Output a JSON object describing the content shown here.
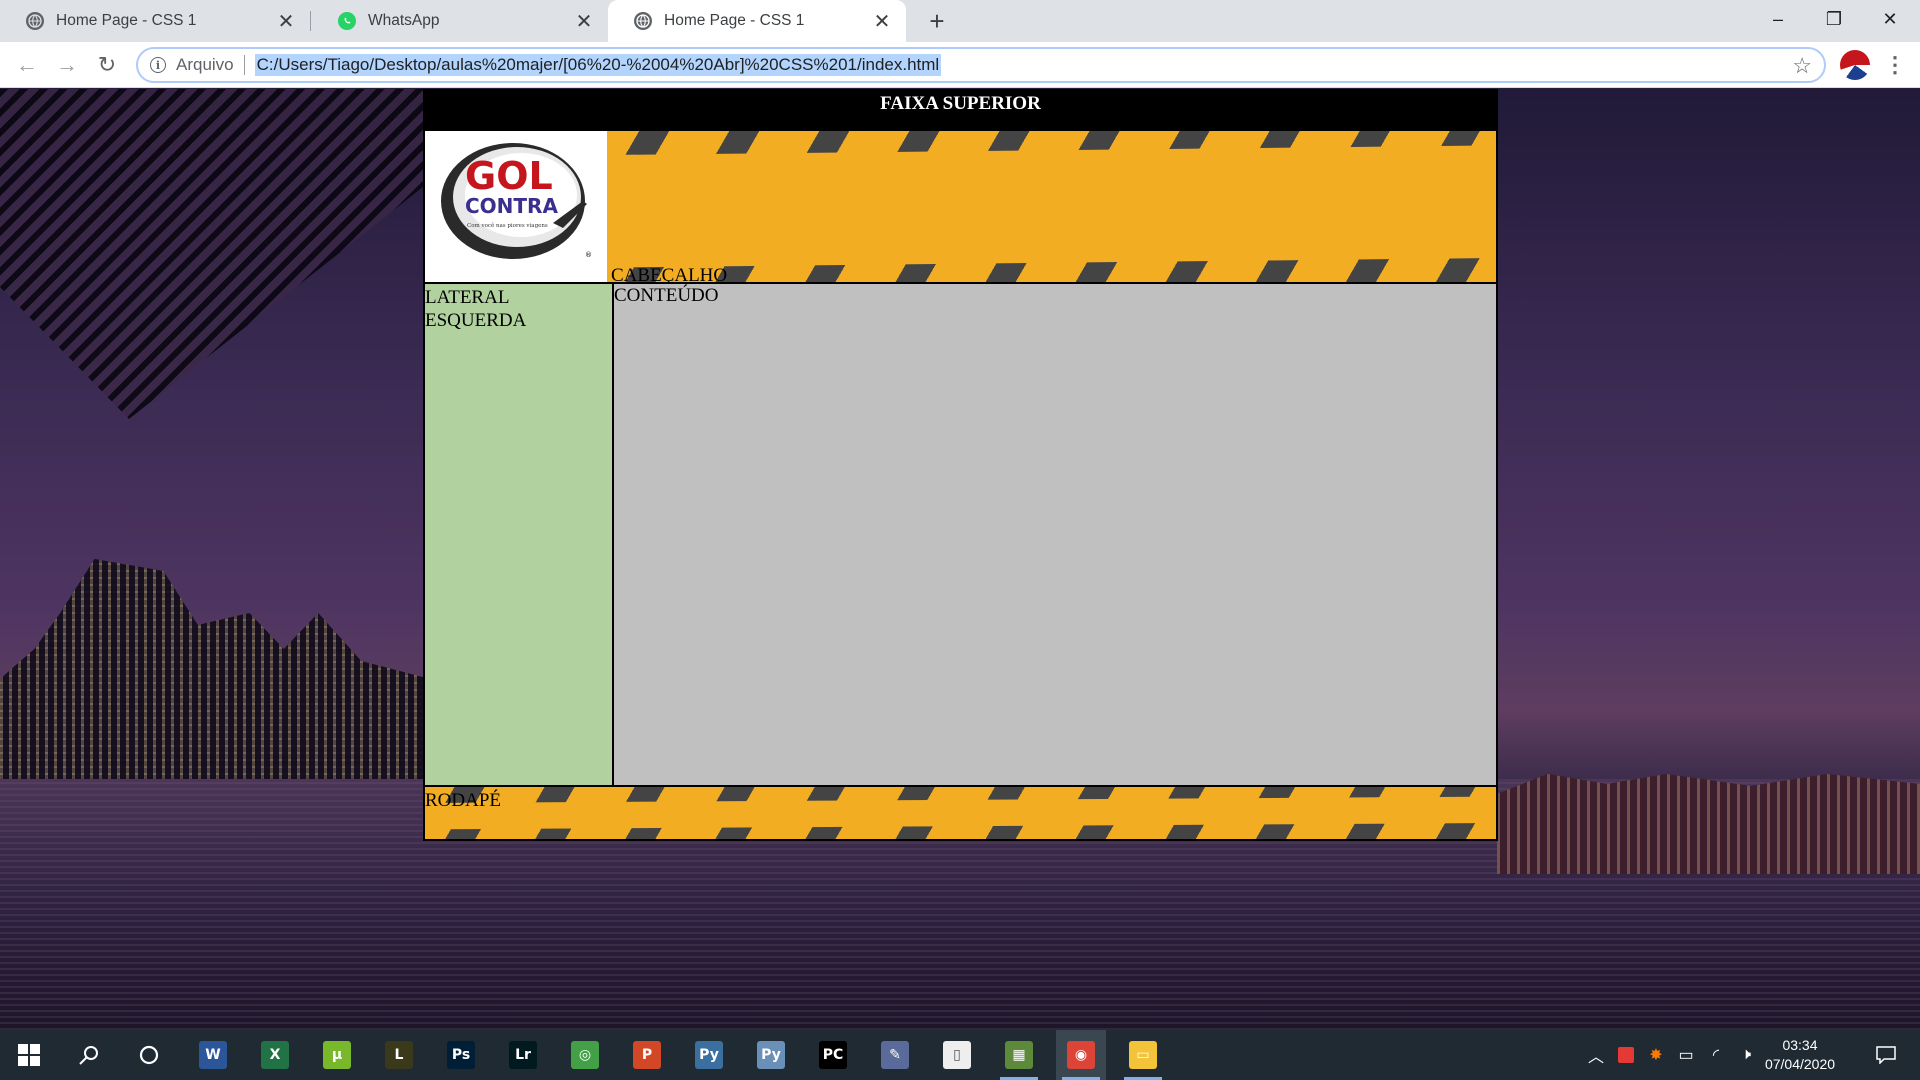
{
  "browser": {
    "tabs": [
      {
        "title": "Home Page - CSS 1",
        "favicon": "globe-icon",
        "active": false
      },
      {
        "title": "WhatsApp",
        "favicon": "whatsapp-icon",
        "active": false
      },
      {
        "title": "Home Page - CSS 1",
        "favicon": "globe-icon",
        "active": true
      }
    ],
    "close_glyph": "✕",
    "new_tab_glyph": "+",
    "window_controls": {
      "minimize": "–",
      "restore": "❐",
      "close": "✕"
    },
    "omnibox": {
      "scheme_label": "Arquivo",
      "url": "C:/Users/Tiago/Desktop/aulas%20majer/[06%20-%2004%20Abr]%20CSS%201/index.html"
    }
  },
  "page": {
    "faixa_superior": "FAIXA SUPERIOR",
    "logo": {
      "word1": "GOL",
      "word2": "CONTRA",
      "tagline": "Com você nas piores viagens",
      "brand_colors": [
        "#c4161c",
        "#3a2f8f"
      ]
    },
    "cabecalho": "CABEÇALHO",
    "lateral_esquerda": "LATERAL ESQUERDA",
    "conteudo": "CONTEÚDO",
    "rodape": "RODAPÉ",
    "colors": {
      "stripe_yellow": "#f2ad22",
      "lateral_green": "#b1d29f",
      "content_gray": "#c0c0c0"
    }
  },
  "taskbar": {
    "apps": [
      {
        "name": "word",
        "label": "W",
        "color": "#2b579a"
      },
      {
        "name": "excel",
        "label": "X",
        "color": "#217346"
      },
      {
        "name": "utorrent",
        "label": "µ",
        "color": "#78b82a"
      },
      {
        "name": "lightroom-lite",
        "label": "L",
        "color": "#3a3a1a"
      },
      {
        "name": "photoshop",
        "label": "Ps",
        "color": "#001e36"
      },
      {
        "name": "lightroom",
        "label": "Lr",
        "color": "#001a1f"
      },
      {
        "name": "razer",
        "label": "◎",
        "color": "#44a047"
      },
      {
        "name": "powerpoint",
        "label": "P",
        "color": "#d24726"
      },
      {
        "name": "python",
        "label": "Py",
        "color": "#3a6fa0"
      },
      {
        "name": "python-file",
        "label": "Py",
        "color": "#6a8fb8"
      },
      {
        "name": "pycharm",
        "label": "PC",
        "color": "#000000"
      },
      {
        "name": "editor",
        "label": "✎",
        "color": "#5a6a9a"
      },
      {
        "name": "notepad",
        "label": "▯",
        "color": "#eeeeee"
      },
      {
        "name": "minecraft",
        "label": "▦",
        "color": "#5d8a3a"
      },
      {
        "name": "chrome",
        "label": "◉",
        "color": "#db4437"
      },
      {
        "name": "file-explorer",
        "label": "▭",
        "color": "#f3c33a"
      }
    ],
    "clock": {
      "time": "03:34",
      "date": "07/04/2020"
    }
  }
}
